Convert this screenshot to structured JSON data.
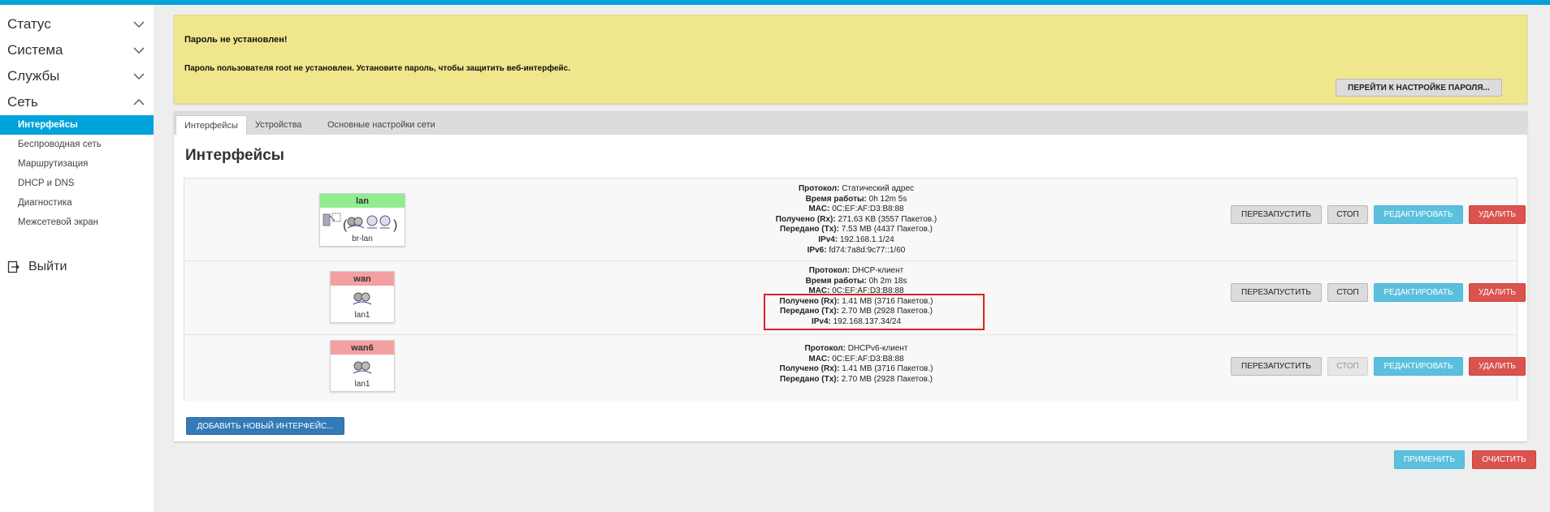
{
  "sidebar": {
    "menus": [
      {
        "label": "Статус",
        "expanded": false
      },
      {
        "label": "Система",
        "expanded": false
      },
      {
        "label": "Службы",
        "expanded": false
      },
      {
        "label": "Сеть",
        "expanded": true
      }
    ],
    "network_items": [
      {
        "label": "Интерфейсы",
        "active": true
      },
      {
        "label": "Беспроводная сеть",
        "active": false
      },
      {
        "label": "Маршрутизация",
        "active": false
      },
      {
        "label": "DHCP и DNS",
        "active": false
      },
      {
        "label": "Диагностика",
        "active": false
      },
      {
        "label": "Межсетевой экран",
        "active": false
      }
    ],
    "logout_label": "Выйти"
  },
  "warning": {
    "title": "Пароль не установлен!",
    "text": "Пароль пользователя root не установлен. Установите пароль, чтобы защитить веб-интерфейс.",
    "button": "ПЕРЕЙТИ К НАСТРОЙКЕ ПАРОЛЯ..."
  },
  "tabs": [
    "Интерфейсы",
    "Устройства",
    "Основные настройки сети"
  ],
  "page_title": "Интерфейсы",
  "interfaces": [
    {
      "name": "lan",
      "head_color": "#90ee90",
      "device": "br-lan",
      "info": [
        {
          "k": "Протокол:",
          "v": "Статический адрес"
        },
        {
          "k": "Время работы:",
          "v": "0h 12m 5s"
        },
        {
          "k": "MAC:",
          "v": "0C:EF:AF:D3:B8:88"
        },
        {
          "k": "Получено (Rx):",
          "v": "271.63 KB (3557 Пакетов.)"
        },
        {
          "k": "Передано (Tx):",
          "v": "7.53 MB (4437 Пакетов.)"
        },
        {
          "k": "IPv4:",
          "v": "192.168.1.1/24"
        },
        {
          "k": "IPv6:",
          "v": "fd74:7a8d:9c77::1/60"
        }
      ],
      "stop_disabled": false
    },
    {
      "name": "wan",
      "head_color": "#f4a0a0",
      "device": "lan1",
      "info": [
        {
          "k": "Протокол:",
          "v": "DHCP-клиент"
        },
        {
          "k": "Время работы:",
          "v": "0h 2m 18s"
        },
        {
          "k": "MAC:",
          "v": "0C:EF:AF:D3:B8:88"
        },
        {
          "k": "Получено (Rx):",
          "v": "1.41 MB (3716 Пакетов.)"
        },
        {
          "k": "Передано (Tx):",
          "v": "2.70 MB (2928 Пакетов.)"
        },
        {
          "k": "IPv4:",
          "v": "192.168.137.34/24"
        }
      ],
      "stop_disabled": false
    },
    {
      "name": "wan6",
      "head_color": "#f4a0a0",
      "device": "lan1",
      "info": [
        {
          "k": "Протокол:",
          "v": "DHCPv6-клиент"
        },
        {
          "k": "MAC:",
          "v": "0C:EF:AF:D3:B8:88"
        },
        {
          "k": "Получено (Rx):",
          "v": "1.41 MB (3716 Пакетов.)"
        },
        {
          "k": "Передано (Tx):",
          "v": "2.70 MB (2928 Пакетов.)"
        }
      ],
      "stop_disabled": true
    }
  ],
  "row_buttons": {
    "restart": "ПЕРЕЗАПУСТИТЬ",
    "stop": "СТОП",
    "edit": "РЕДАКТИРОВАТЬ",
    "delete": "УДАЛИТЬ"
  },
  "add_button": "ДОБАВИТЬ НОВЫЙ ИНТЕРФЕЙС...",
  "footer": {
    "apply": "ПРИМЕНИТЬ",
    "reset": "ОЧИСТИТЬ"
  },
  "colors": {
    "accent": "#00a3d9",
    "warning_bg": "#f0e68c",
    "highlight": "#e02020"
  }
}
